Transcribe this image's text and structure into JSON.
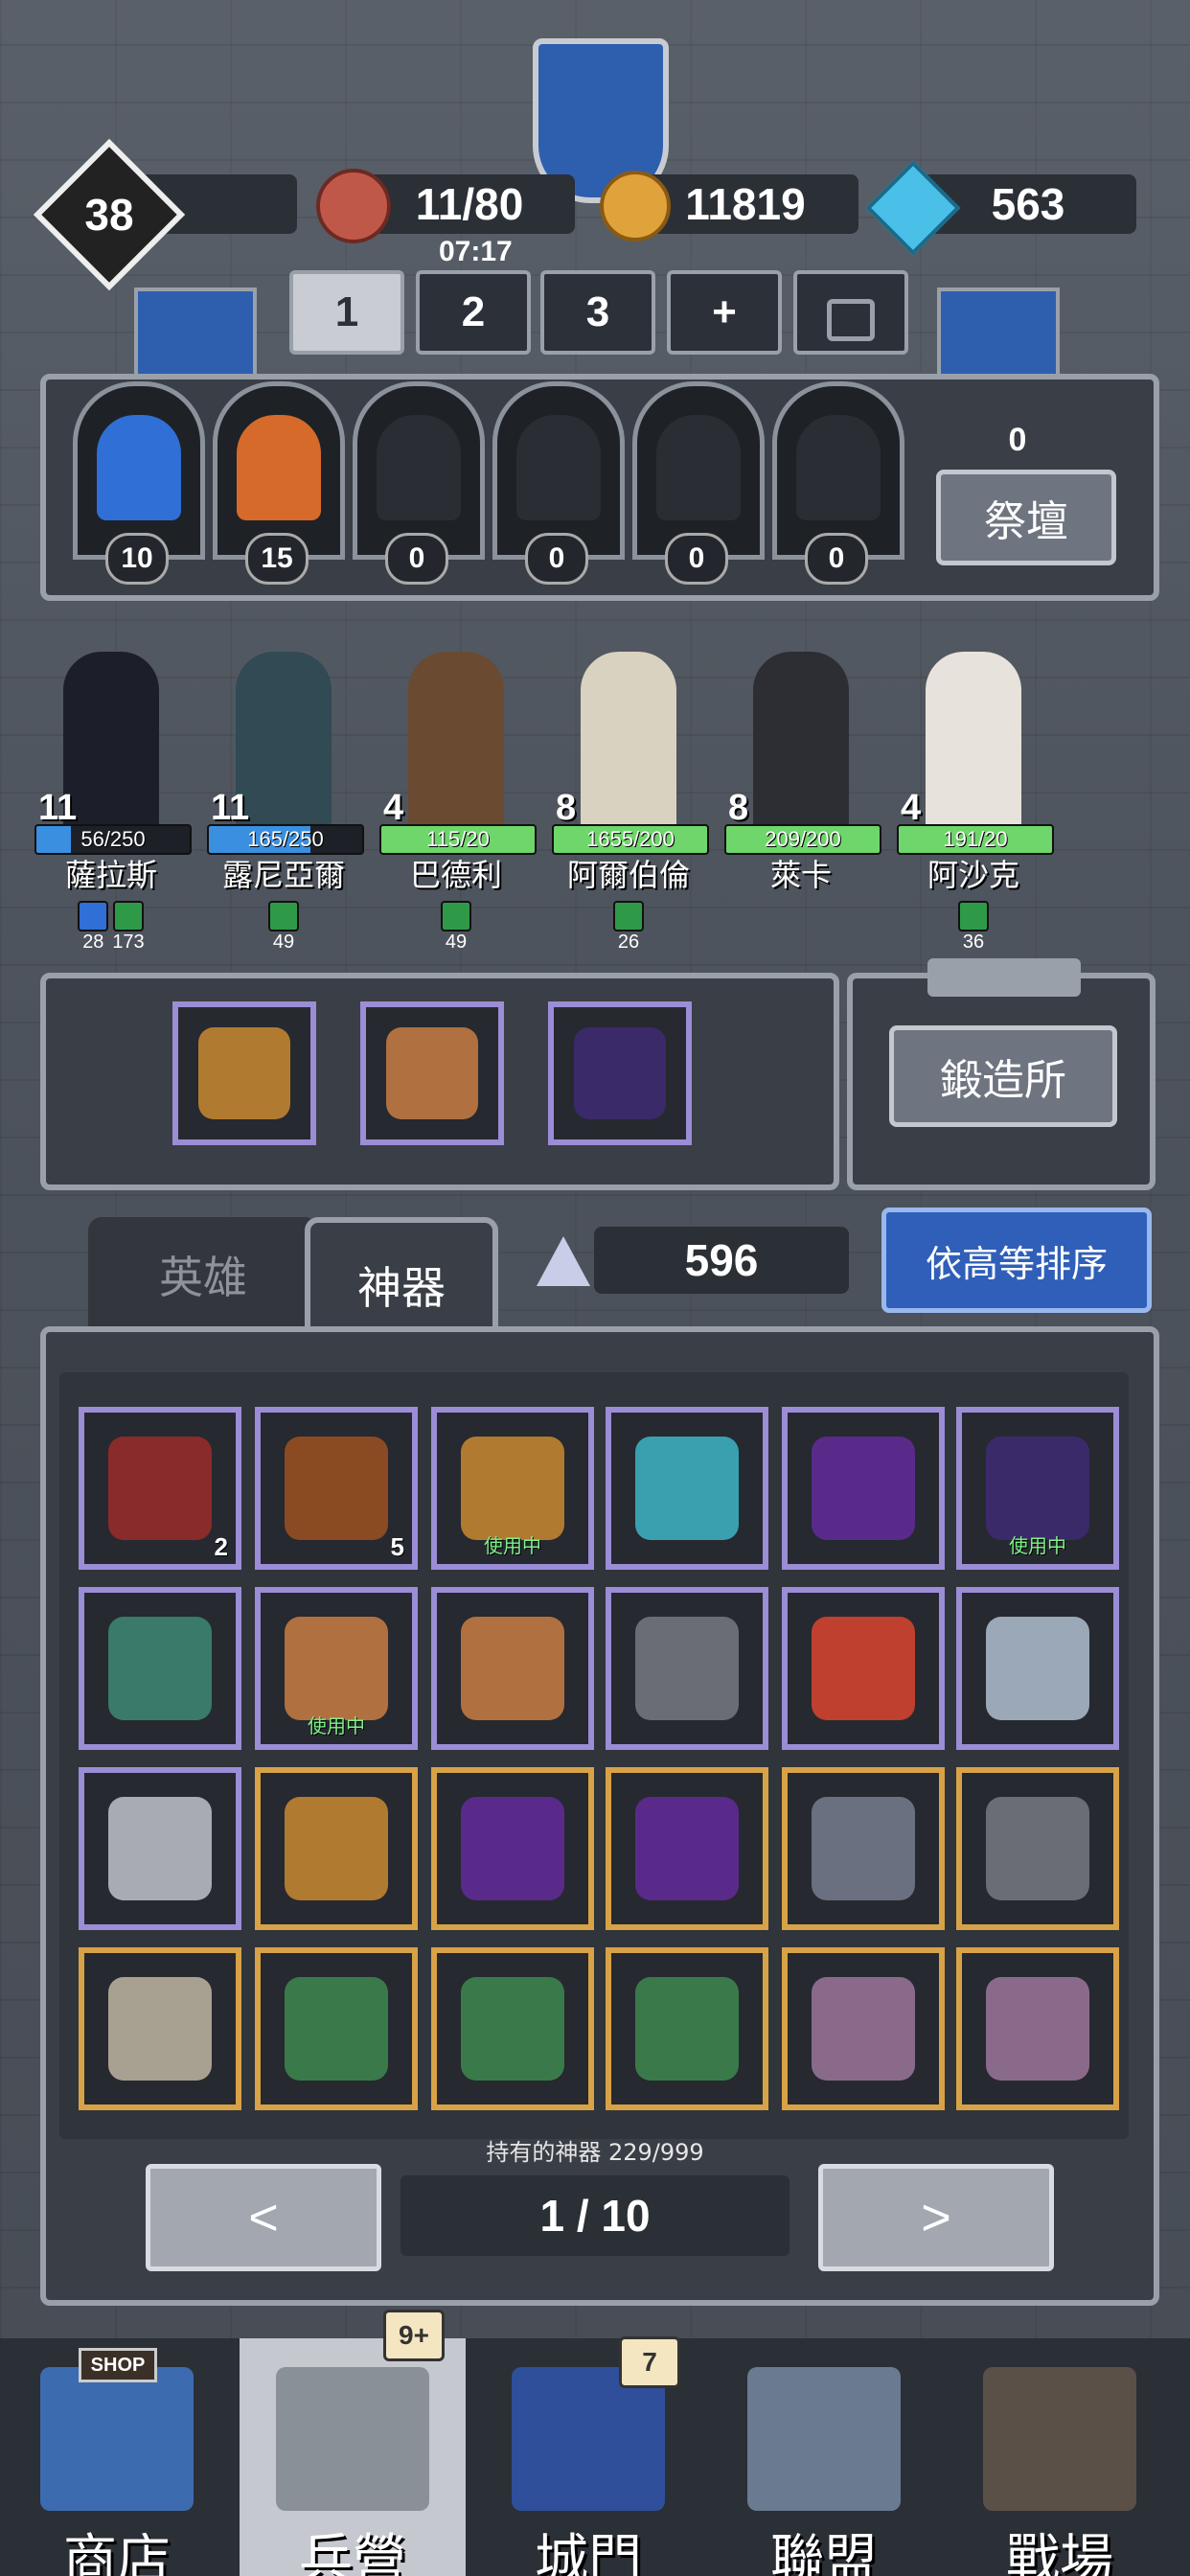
{
  "top": {
    "level": "38",
    "food": "11/80",
    "timer": "07:17",
    "gold": "11819",
    "gems": "563"
  },
  "teams": [
    "1",
    "2",
    "3",
    "+"
  ],
  "altar": {
    "counts": [
      "10",
      "15",
      "0",
      "0",
      "0",
      "0"
    ],
    "total": "0",
    "button": "祭壇"
  },
  "heroes": [
    {
      "level": "11",
      "hp": "56/250",
      "hp_frac": 0.224,
      "bar": "#3b8fe0",
      "name": "薩拉斯",
      "stats": [
        {
          "color": "#2f6fd6",
          "value": "28"
        },
        {
          "color": "#2e9a48",
          "value": "173"
        }
      ],
      "sprite": "#1c1f2a"
    },
    {
      "level": "11",
      "hp": "165/250",
      "hp_frac": 0.66,
      "bar": "#3b8fe0",
      "name": "露尼亞爾",
      "stats": [
        {
          "color": "#2e9a48",
          "value": "49"
        }
      ],
      "sprite": "#314a54"
    },
    {
      "level": "4",
      "hp": "115/20",
      "hp_frac": 1.0,
      "bar": "#6ed66a",
      "name": "巴德利",
      "stats": [
        {
          "color": "#2e9a48",
          "value": "49"
        }
      ],
      "sprite": "#6a4a30"
    },
    {
      "level": "8",
      "hp": "1655/200",
      "hp_frac": 1.0,
      "bar": "#6ed66a",
      "name": "阿爾伯倫",
      "stats": [
        {
          "color": "#2e9a48",
          "value": "26"
        }
      ],
      "sprite": "#d9d2c0"
    },
    {
      "level": "8",
      "hp": "209/200",
      "hp_frac": 1.0,
      "bar": "#6ed66a",
      "name": "萊卡",
      "stats": [],
      "sprite": "#2c2e33"
    },
    {
      "level": "4",
      "hp": "191/20",
      "hp_frac": 1.0,
      "bar": "#6ed66a",
      "name": "阿沙克",
      "stats": [
        {
          "color": "#2e9a48",
          "value": "36"
        }
      ],
      "sprite": "#e8e2dc"
    }
  ],
  "forge_button": "鍛造所",
  "tabs": {
    "heroes": "英雄",
    "artifacts": "神器"
  },
  "shards": "596",
  "sort_button": "依高等排序",
  "inuse_label": "使用中",
  "artifacts": [
    [
      {
        "frame": "purple",
        "icon": "rune-box-icon",
        "color": "#8a2b2b",
        "count": "2"
      },
      {
        "frame": "purple",
        "icon": "rune-box-icon",
        "color": "#8a4a22",
        "count": "5"
      },
      {
        "frame": "purple",
        "icon": "spyglass-icon",
        "color": "#b07a30",
        "inuse": true
      },
      {
        "frame": "purple",
        "icon": "crystal-staff-icon",
        "color": "#3aa0b0"
      },
      {
        "frame": "purple",
        "icon": "dark-eye-icon",
        "color": "#5a2a8a"
      },
      {
        "frame": "purple",
        "icon": "mask-icon",
        "color": "#3a2a6a",
        "inuse": true
      }
    ],
    [
      {
        "frame": "purple",
        "icon": "feather-icon",
        "color": "#3a7a6a"
      },
      {
        "frame": "purple",
        "icon": "scepter-icon",
        "color": "#b07040",
        "inuse": true
      },
      {
        "frame": "purple",
        "icon": "scepter-icon",
        "color": "#b07040"
      },
      {
        "frame": "purple",
        "icon": "book-icon",
        "color": "#6a6e74"
      },
      {
        "frame": "purple",
        "icon": "crown-icon",
        "color": "#c04030"
      },
      {
        "frame": "purple",
        "icon": "serpent-icon",
        "color": "#9aa8b8"
      }
    ],
    [
      {
        "frame": "purple",
        "icon": "armor-icon",
        "color": "#a8acb2"
      },
      {
        "frame": "gold",
        "icon": "spyglass-icon",
        "color": "#b07a30"
      },
      {
        "frame": "gold",
        "icon": "dark-eye-icon",
        "color": "#5a2a8a"
      },
      {
        "frame": "gold",
        "icon": "dark-eye-icon",
        "color": "#5a2a8a"
      },
      {
        "frame": "gold",
        "icon": "scroll-icon",
        "color": "#6a7080"
      },
      {
        "frame": "gold",
        "icon": "book-icon",
        "color": "#6a6e74"
      }
    ],
    [
      {
        "frame": "gold",
        "icon": "horn-icon",
        "color": "#a8a090"
      },
      {
        "frame": "gold",
        "icon": "herb-icon",
        "color": "#3a7a4a"
      },
      {
        "frame": "gold",
        "icon": "herb-icon",
        "color": "#3a7a4a"
      },
      {
        "frame": "gold",
        "icon": "herb-icon",
        "color": "#3a7a4a"
      },
      {
        "frame": "gold",
        "icon": "sword-icon",
        "color": "#8a6a8a"
      },
      {
        "frame": "gold",
        "icon": "sword-icon",
        "color": "#8a6a8a"
      }
    ]
  ],
  "owned_text": "持有的神器 229/999",
  "pager": {
    "prev": "<",
    "indicator": "1 / 10",
    "next": ">"
  },
  "nav": [
    {
      "label": "商店",
      "icon": "shop-icon",
      "color": "#3d6bb0",
      "sign": "SHOP"
    },
    {
      "label": "兵營",
      "icon": "barracks-icon",
      "color": "#8a9098",
      "badge": "9+",
      "active": true
    },
    {
      "label": "城門",
      "icon": "gate-icon",
      "color": "#2f4f9a",
      "badge": "7"
    },
    {
      "label": "聯盟",
      "icon": "alliance-icon",
      "color": "#6a7a90"
    },
    {
      "label": "戰場",
      "icon": "battlefield-icon",
      "color": "#5a5048"
    }
  ]
}
